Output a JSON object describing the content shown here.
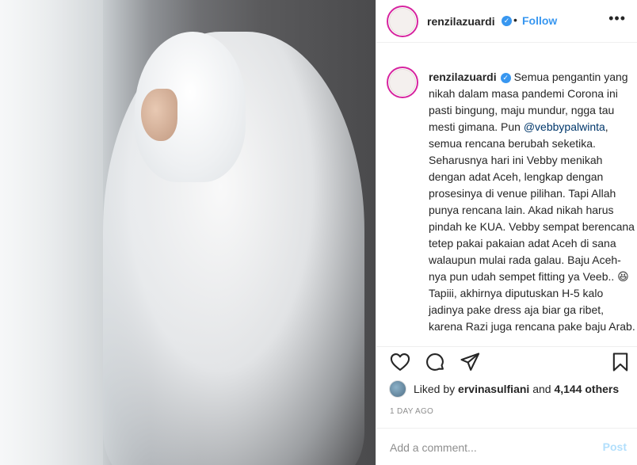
{
  "header": {
    "username": "renzilazuardi",
    "separator": "•",
    "follow_label": "Follow",
    "more_icon": "more-horizontal-icon"
  },
  "caption": {
    "username": "renzilazuardi",
    "text_before_mention": "Semua pengantin yang nikah dalam masa pandemi Corona ini pasti bingung, maju mundur, ngga tau mesti gimana. Pun ",
    "mention": "@vebbypalwinta",
    "text_after_mention": ", semua rencana berubah seketika. Seharusnya hari ini Vebby menikah dengan adat Aceh, lengkap dengan prosesinya di venue pilihan. Tapi Allah punya rencana lain. Akad nikah harus pindah ke KUA. Vebby sempat berencana tetep pakai pakaian adat Aceh di sana walaupun mulai rada galau. Baju Aceh-nya pun udah sempet fitting ya Veeb.. 😆 Tapiii, akhirnya diputuskan H-5 kalo jadinya pake dress aja biar ga ribet, karena Razi juga rencana pake baju Arab. Vebby nanya “Kak Renzi ada dress putih ready?”. Aku bilang adaaa, tenang ajaa *biar"
  },
  "likes": {
    "prefix": "Liked by ",
    "user": "ervinasulfiani",
    "conjunction": " and ",
    "count": "4,144 others"
  },
  "timestamp": "1 DAY AGO",
  "comment": {
    "placeholder": "Add a comment...",
    "post_label": "Post"
  },
  "colors": {
    "accent": "#3897f0",
    "post_disabled": "#b2dffc",
    "muted": "#8e8e8e",
    "text": "#262626",
    "border": "#efefef"
  }
}
